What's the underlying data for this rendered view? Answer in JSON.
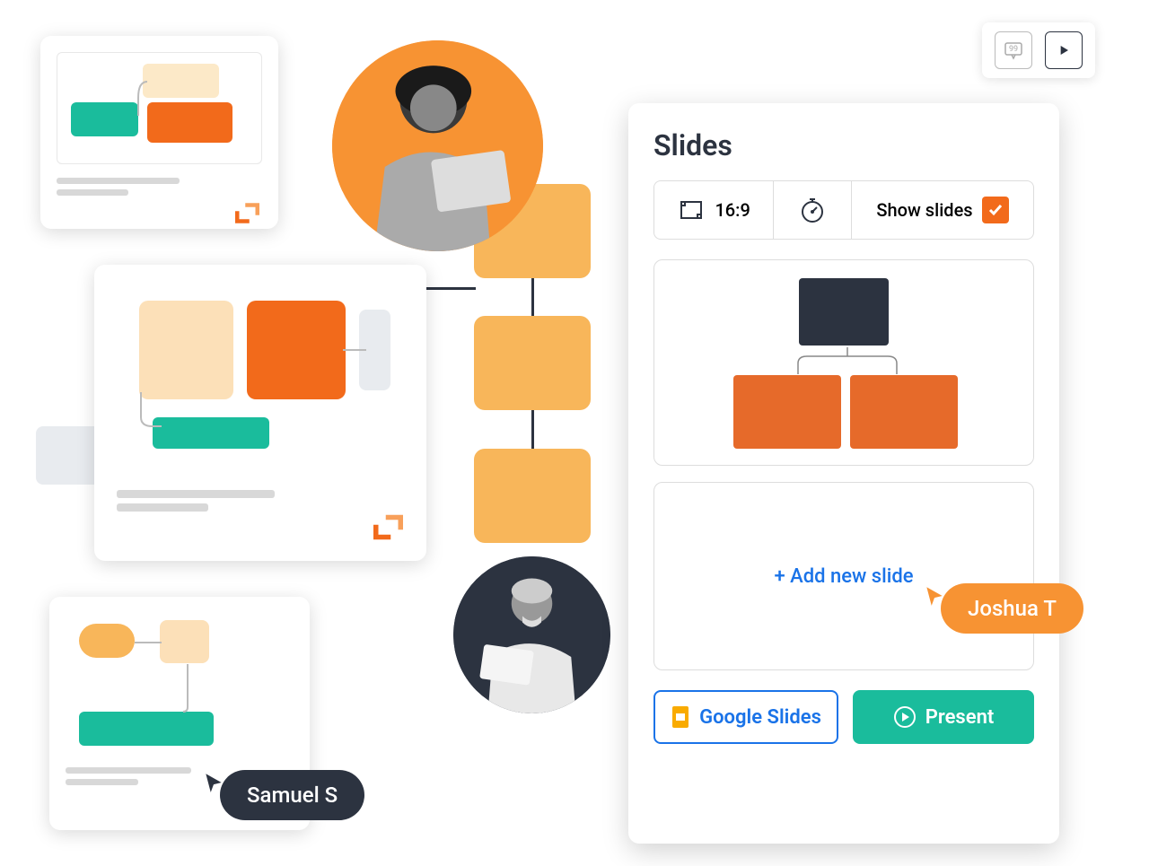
{
  "slides_panel": {
    "title": "Slides",
    "aspect_ratio": "16:9",
    "show_slides_label": "Show slides",
    "add_new_slide": "+  Add new slide",
    "google_slides_btn": "Google Slides",
    "present_btn": "Present"
  },
  "cursors": {
    "samuel": "Samuel S",
    "joshua": "Joshua T"
  },
  "colors": {
    "orange": "#f26a1b",
    "orange_light": "#f8b65a",
    "teal": "#1abc9c",
    "dark": "#2c3340",
    "blue": "#1a73e8"
  }
}
